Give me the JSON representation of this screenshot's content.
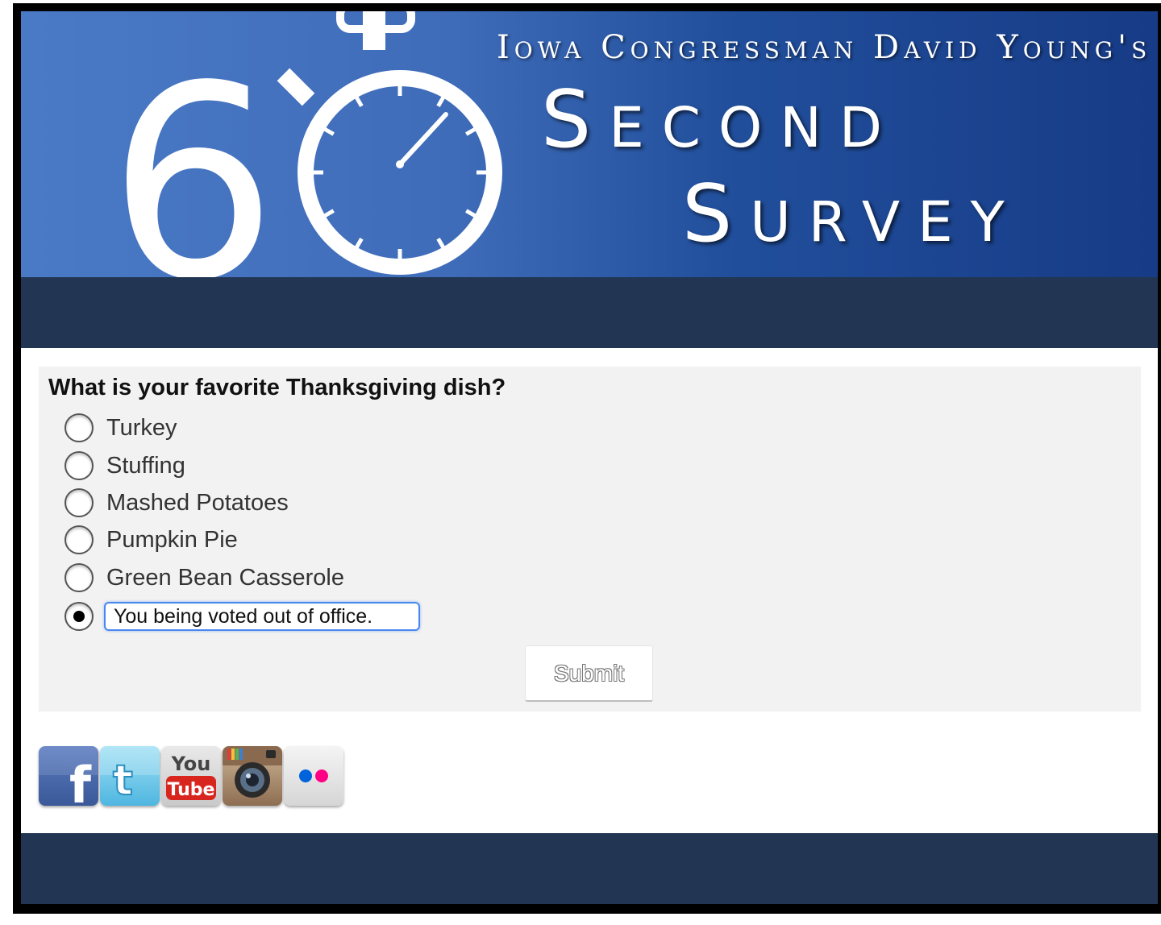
{
  "banner": {
    "subtitle": "Iowa Congressman David Young's",
    "title_line1": "Second",
    "title_line2": "Survey",
    "number": "6"
  },
  "survey": {
    "question": "What is your favorite Thanksgiving dish?",
    "options": [
      {
        "label": "Turkey",
        "selected": false
      },
      {
        "label": "Stuffing",
        "selected": false
      },
      {
        "label": "Mashed Potatoes",
        "selected": false
      },
      {
        "label": "Pumpkin Pie",
        "selected": false
      },
      {
        "label": "Green Bean Casserole",
        "selected": false
      }
    ],
    "other": {
      "value": "You being voted out of office.",
      "selected": true
    },
    "submit_label": "Submit"
  },
  "social": [
    {
      "name": "facebook-icon",
      "glyph": "f"
    },
    {
      "name": "twitter-icon",
      "glyph": "t"
    },
    {
      "name": "youtube-icon",
      "glyph_top": "You",
      "glyph_bottom": "Tube"
    },
    {
      "name": "instagram-icon"
    },
    {
      "name": "flickr-icon"
    }
  ],
  "colors": {
    "nav": "#223653",
    "banner_dark": "#173b86",
    "banner_light": "#4a7ac6",
    "input_focus": "#4a88f0",
    "survey_bg": "#f2f2f2"
  }
}
